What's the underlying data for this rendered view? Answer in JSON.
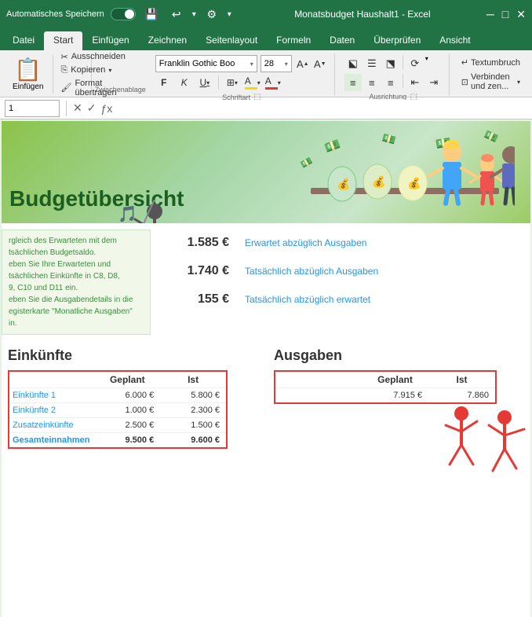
{
  "titlebar": {
    "autosave_label": "Automatisches Speichern",
    "filename": "Monatsbudget Haushalt1 - Excel"
  },
  "ribbon": {
    "tabs": [
      "Datei",
      "Start",
      "Einfügen",
      "Zeichnen",
      "Seitenlayout",
      "Formeln",
      "Daten",
      "Überprüfen",
      "Ansicht"
    ],
    "active_tab": "Start",
    "clipboard": {
      "paste_label": "Einfügen",
      "cut_label": "Ausschneiden",
      "copy_label": "Kopieren",
      "format_label": "Format übertragen"
    },
    "font": {
      "font_name": "Franklin Gothic Boo",
      "font_size": "28",
      "bold": "F",
      "italic": "K",
      "underline": "U"
    },
    "groups": {
      "schriftart": "Schriftart",
      "ausrichtung": "Ausrichtung",
      "zwischenablage": "Zwischenablage"
    },
    "alignment": {
      "textumbruch": "Textumbruch",
      "verbinden": "Verbinden und zen..."
    }
  },
  "formula_bar": {
    "name_box": "1",
    "formula": ""
  },
  "spreadsheet": {
    "header_title": "Budgetübersicht",
    "info_box": {
      "line1": "rgleich des Erwarteten mit dem",
      "line2": "tsächlichen Budgetsaldo.",
      "line3": "eben Sie Ihre Erwarteten und",
      "line4": "tsächlichen Einkünfte in C8, D8,",
      "line5": "9, C10 und D11 ein.",
      "line6": "eben Sie die Ausgabendetails in die",
      "line7": "egisterkarte \"Monatliche Ausgaben\"",
      "line8": "in."
    },
    "amounts": [
      {
        "value": "1.585 €",
        "label": "Erwartet abzüglich Ausgaben"
      },
      {
        "value": "1.740 €",
        "label": "Tatsächlich abzüglich Ausgaben"
      },
      {
        "value": "155 €",
        "label": "Tatsächlich abzüglich erwartet"
      }
    ],
    "einkunfte_title": "Einkünfte",
    "einkunfte_table": {
      "col_geplant": "Geplant",
      "col_ist": "Ist",
      "rows": [
        {
          "label": "Einkünfte 1",
          "geplant": "6.000 €",
          "ist": "5.800 €"
        },
        {
          "label": "Einkünfte 2",
          "geplant": "1.000 €",
          "ist": "2.300 €"
        },
        {
          "label": "Zusatzeinkünfte",
          "geplant": "2.500 €",
          "ist": "1.500 €"
        },
        {
          "label": "Gesamteinnahmen",
          "geplant": "9.500 €",
          "ist": "9.600 €"
        }
      ]
    },
    "ausgaben_title": "Ausgaben",
    "ausgaben_table": {
      "col_geplant": "Geplant",
      "col_ist": "Ist",
      "rows": [
        {
          "label": "",
          "geplant": "7.915 €",
          "ist": "7.860"
        }
      ]
    }
  },
  "colors": {
    "excel_green": "#217346",
    "light_green": "#e8f5e9",
    "red_accent": "#e53935",
    "blue_link": "#2196f3",
    "header_bg": "#8bc34a"
  }
}
